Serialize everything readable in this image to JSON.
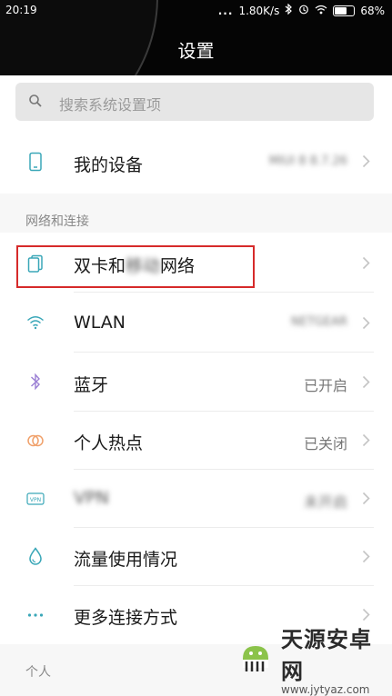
{
  "status_bar": {
    "time": "20:19",
    "signal_dots": "...",
    "speed": "1.80K/s",
    "battery": "68%",
    "battery_level": 0.68
  },
  "header": {
    "title": "设置"
  },
  "search": {
    "placeholder": "搜索系统设置项"
  },
  "my_device": {
    "label": "我的设备",
    "value": "MIUI 8 8.7.26"
  },
  "sections": {
    "network": "网络和连接",
    "personal": "个人"
  },
  "network_items": [
    {
      "label": "双卡和移动网络",
      "label_visible_prefix": "双卡和",
      "label_blurred": "移动",
      "label_visible_suffix": "网络",
      "value": "",
      "icon": "dual-sim-icon"
    },
    {
      "label": "WLAN",
      "value": "NETGEAR",
      "icon": "wifi-icon"
    },
    {
      "label": "蓝牙",
      "value": "已开启",
      "icon": "bluetooth-icon"
    },
    {
      "label": "个人热点",
      "value": "已关闭",
      "icon": "hotspot-icon"
    },
    {
      "label": "VPN",
      "value": "未开启",
      "icon": "vpn-icon"
    },
    {
      "label": "流量使用情况",
      "value": "",
      "icon": "water-drop-icon"
    },
    {
      "label": "更多连接方式",
      "value": "",
      "icon": "more-dots-icon"
    }
  ],
  "watermark": {
    "main": "天源安卓网",
    "sub": "www.jytyaz.com"
  },
  "colors": {
    "accent_teal": "#3aa7b8",
    "bluetooth_purple": "#9b7fd4",
    "hotspot_orange": "#f0a06a",
    "highlight_red": "#d62a2a"
  }
}
